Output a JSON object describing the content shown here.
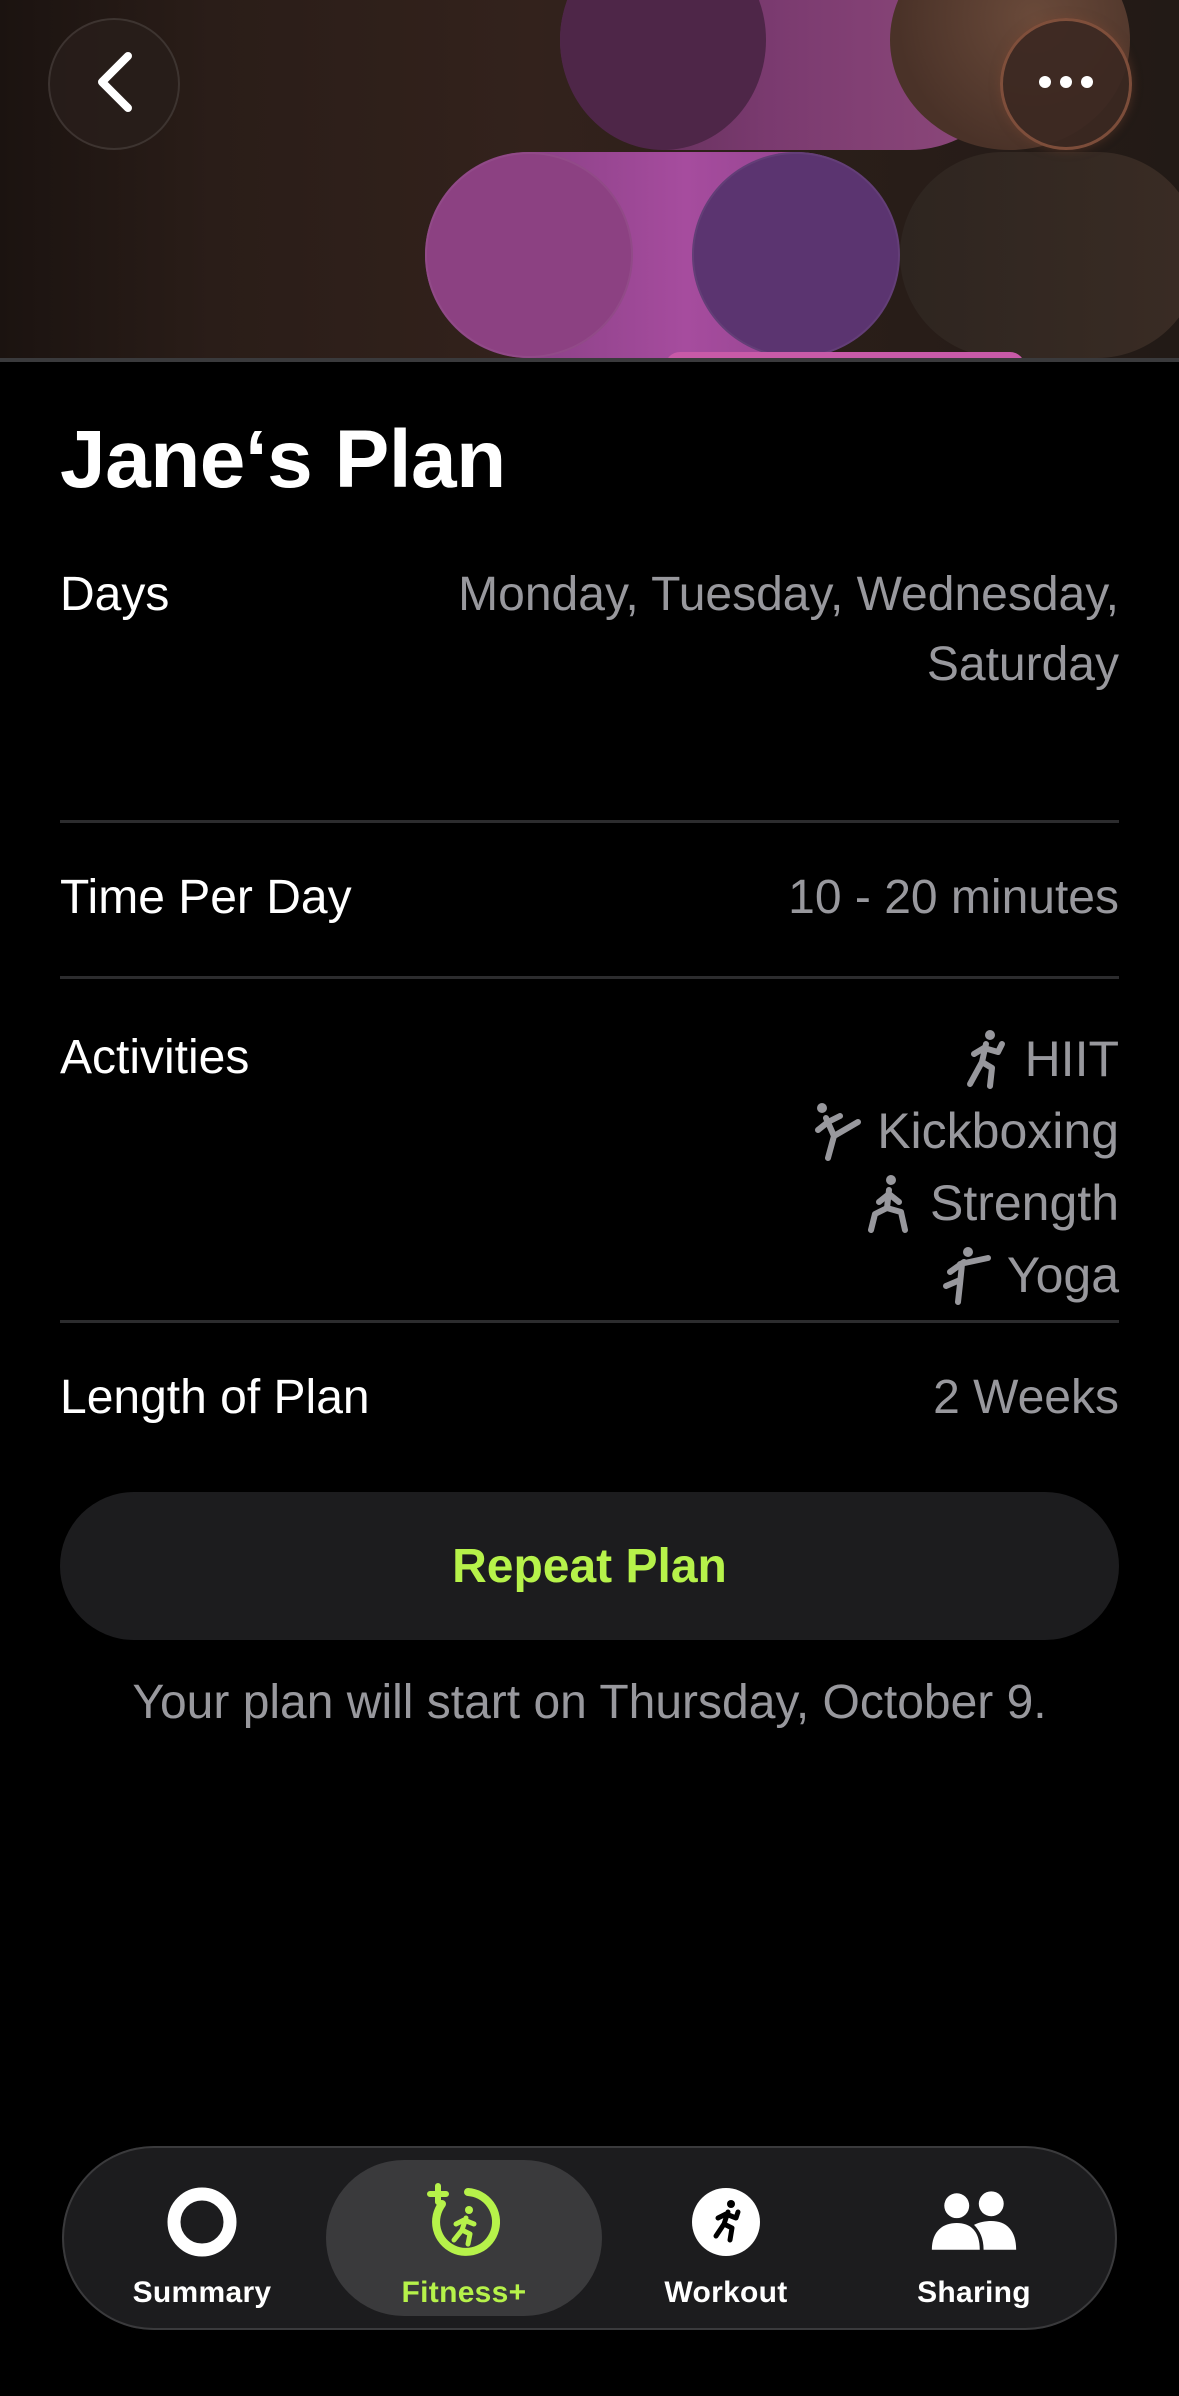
{
  "header": {
    "back_icon": "chevron-left-icon",
    "more_icon": "ellipsis-icon"
  },
  "plan": {
    "title": "Jane‘s Plan",
    "rows": {
      "days": {
        "label": "Days",
        "value_line1": "Monday, Tuesday, Wednesday,",
        "value_line2": "Saturday"
      },
      "time": {
        "label": "Time Per Day",
        "value": "10 - 20 minutes"
      },
      "activities": {
        "label": "Activities",
        "items": [
          {
            "label": "HIIT",
            "icon": "hiit-icon"
          },
          {
            "label": "Kickboxing",
            "icon": "kickboxing-icon"
          },
          {
            "label": "Strength",
            "icon": "strength-icon"
          },
          {
            "label": "Yoga",
            "icon": "yoga-icon"
          }
        ]
      },
      "length": {
        "label": "Length of Plan",
        "value": "2 Weeks"
      }
    }
  },
  "action": {
    "repeat_label": "Repeat Plan",
    "note": "Your plan will start on Thursday, October 9."
  },
  "tab_bar": {
    "selected": "Fitness+",
    "tabs": [
      {
        "label": "Summary",
        "icon": "activity-ring-icon"
      },
      {
        "label": "Fitness+",
        "icon": "fitness-plus-icon"
      },
      {
        "label": "Workout",
        "icon": "running-figure-icon"
      },
      {
        "label": "Sharing",
        "icon": "people-icon"
      }
    ]
  },
  "colors": {
    "background": "#000000",
    "accent": "#b6f24a",
    "secondary_text": "#98989d",
    "surface": "#1c1c1e",
    "header_pink": "#a64c9e",
    "header_purple": "#5b3470"
  }
}
